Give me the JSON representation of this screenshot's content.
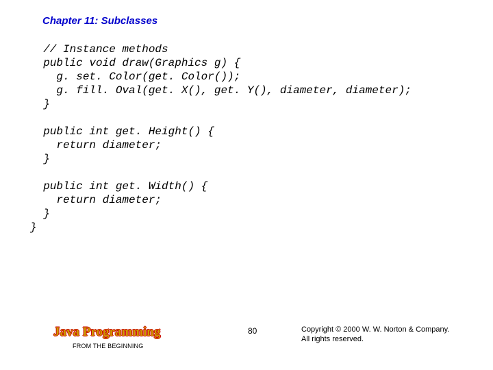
{
  "chapter": {
    "title": "Chapter 11: Subclasses"
  },
  "code": {
    "l01": "  // Instance methods",
    "l02": "  public void draw(Graphics g) {",
    "l03": "    g. set. Color(get. Color());",
    "l04": "    g. fill. Oval(get. X(), get. Y(), diameter, diameter);",
    "l05": "  }",
    "l06": "",
    "l07": "  public int get. Height() {",
    "l08": "    return diameter;",
    "l09": "  }",
    "l10": "",
    "l11": "  public int get. Width() {",
    "l12": "    return diameter;",
    "l13": "  }",
    "l14": "}"
  },
  "footer": {
    "book_title": "Java Programming",
    "book_sub": "FROM THE BEGINNING",
    "page": "80",
    "copyright_l1": "Copyright © 2000 W. W. Norton & Company.",
    "copyright_l2": "All rights reserved."
  }
}
